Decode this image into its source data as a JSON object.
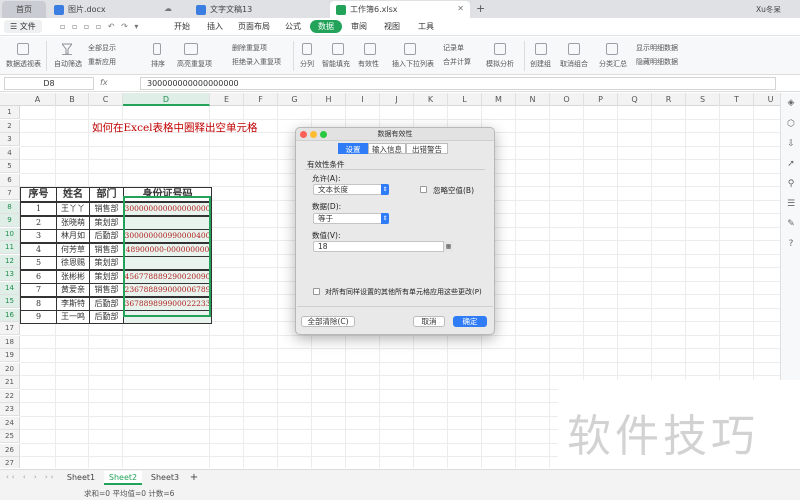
{
  "tabs": {
    "home": "首页",
    "doc1": "图片.docx",
    "doc2": "文字文稿13",
    "doc3": "工作簿6.xlsx",
    "add": "+",
    "user": "Xu冬呆"
  },
  "menu": {
    "file": "文件",
    "items": [
      "开始",
      "插入",
      "页面布局",
      "公式",
      "数据",
      "审阅",
      "视图",
      "工具"
    ],
    "active_index": 4
  },
  "ribbon": {
    "items": [
      "数据透视表",
      "自动筛选",
      "全部显示",
      "重新应用",
      "排序",
      "高亮重复项",
      "删除重复项",
      "拒绝录入重复项",
      "分列",
      "智能填充",
      "有效性",
      "插入下拉列表",
      "记录单",
      "合并计算",
      "模拟分析",
      "创建组",
      "取消组合",
      "分类汇总",
      "显示明细数据",
      "隐藏明细数据"
    ]
  },
  "formula_bar": {
    "name_box": "D8",
    "fx": "fx",
    "value": "300000000000000000"
  },
  "columns": [
    "A",
    "B",
    "C",
    "D",
    "E",
    "F",
    "G",
    "H",
    "I",
    "J",
    "K",
    "L",
    "M",
    "N",
    "O",
    "P",
    "Q",
    "R",
    "S",
    "T",
    "U"
  ],
  "rows": [
    "1",
    "2",
    "3",
    "4",
    "5",
    "6",
    "7",
    "8",
    "9",
    "10",
    "11",
    "12",
    "13",
    "14",
    "15",
    "16",
    "17",
    "18",
    "19",
    "20",
    "21",
    "22",
    "23",
    "24",
    "25",
    "26",
    "27"
  ],
  "heading": "如何在Excel表格中圈释出空单元格",
  "table": {
    "headers": [
      "序号",
      "姓名",
      "部门",
      "身份证号码"
    ],
    "rows": [
      [
        "1",
        "王丫丫",
        "销售部",
        "300000000000000000"
      ],
      [
        "2",
        "张晓萌",
        "策划部",
        ""
      ],
      [
        "3",
        "林月如",
        "后勤部",
        "300000000990000400"
      ],
      [
        "4",
        "何芳草",
        "销售部",
        "48900000-000000000"
      ],
      [
        "5",
        "徐恩赐",
        "策划部",
        ""
      ],
      [
        "6",
        "张彬彬",
        "策划部",
        "456778889290020090"
      ],
      [
        "7",
        "黄爱亲",
        "销售部",
        "236788899000006789"
      ],
      [
        "8",
        "李斯特",
        "后勤部",
        "367889899900022233"
      ],
      [
        "9",
        "王一鸣",
        "后勤部",
        ""
      ]
    ]
  },
  "dialog": {
    "title": "数据有效性",
    "tabs": [
      "设置",
      "输入信息",
      "出错警告"
    ],
    "section": "有效性条件",
    "allow_label": "允许(A):",
    "allow_value": "文本长度",
    "ignore_blank": "忽略空值(B)",
    "data_label": "数据(D):",
    "data_value": "等于",
    "value_label": "数值(V):",
    "value_value": "18",
    "apply_all": "对所有同样设置的其他所有单元格应用这些更改(P)",
    "clear_all": "全部清除(C)",
    "cancel": "取消",
    "ok": "确定"
  },
  "sheets": [
    "Sheet1",
    "Sheet2",
    "Sheet3"
  ],
  "active_sheet": "Sheet2",
  "status": "求和=0  平均值=0  计数=6",
  "watermark": "软件技巧",
  "colors": {
    "accent": "#23a35a",
    "dialog_blue": "#2f7cf6",
    "heading_red": "#c00000"
  }
}
